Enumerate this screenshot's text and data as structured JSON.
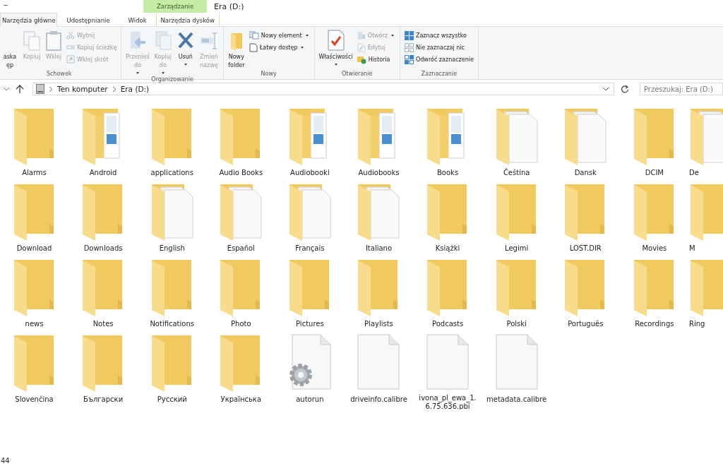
{
  "window": {
    "title": "Era (D:)"
  },
  "context_group": "Zarządzanie",
  "tabs": [
    {
      "label": "Narzędzia główne",
      "selected": true,
      "kind": "normal"
    },
    {
      "label": "Udostępnianie",
      "selected": false,
      "kind": "normal"
    },
    {
      "label": "Widok",
      "selected": false,
      "kind": "normal"
    },
    {
      "label": "Narzędzia dysków",
      "selected": false,
      "kind": "context"
    }
  ],
  "ribbon": [
    {
      "label": "Schowek",
      "items": [
        {
          "kind": "big",
          "label": "aska\nęp",
          "disabled": false,
          "dropdown": false
        },
        {
          "kind": "big",
          "label": "Kopiuj",
          "disabled": true,
          "dropdown": false
        },
        {
          "kind": "big",
          "label": "Wklej",
          "disabled": true,
          "dropdown": false
        },
        {
          "kind": "stack",
          "entries": [
            {
              "label": "Wytnij",
              "disabled": true,
              "dropdown": false
            },
            {
              "label": "Kopiuj ścieżkę",
              "disabled": true,
              "dropdown": false
            },
            {
              "label": "Wklej skrót",
              "disabled": true,
              "dropdown": false
            }
          ]
        }
      ]
    },
    {
      "label": "Organizowanie",
      "items": [
        {
          "kind": "big",
          "label": "Przenieś\ndo",
          "disabled": true,
          "dropdown": true
        },
        {
          "kind": "big",
          "label": "Kopiuj\ndo",
          "disabled": true,
          "dropdown": true
        },
        {
          "kind": "big",
          "label": "Usuń",
          "disabled": false,
          "dropdown": true
        },
        {
          "kind": "big",
          "label": "Zmień\nnazwę",
          "disabled": true,
          "dropdown": false
        }
      ]
    },
    {
      "label": "Nowy",
      "items": [
        {
          "kind": "big",
          "label": "Nowy\nfolder",
          "disabled": false,
          "dropdown": false
        },
        {
          "kind": "stack",
          "entries": [
            {
              "label": "Nowy element",
              "disabled": false,
              "dropdown": true
            },
            {
              "label": "Łatwy dostęp",
              "disabled": false,
              "dropdown": true
            }
          ]
        }
      ]
    },
    {
      "label": "Otwieranie",
      "items": [
        {
          "kind": "big",
          "label": "Właściwości",
          "disabled": false,
          "dropdown": true
        },
        {
          "kind": "stack",
          "entries": [
            {
              "label": "Otwórz",
              "disabled": true,
              "dropdown": true
            },
            {
              "label": "Edytuj",
              "disabled": true,
              "dropdown": false
            },
            {
              "label": "Historia",
              "disabled": false,
              "dropdown": false
            }
          ]
        }
      ]
    },
    {
      "label": "Zaznaczanie",
      "items": [
        {
          "kind": "stack",
          "entries": [
            {
              "label": "Zaznacz wszystko",
              "disabled": false,
              "dropdown": false
            },
            {
              "label": "Nie zaznaczaj nic",
              "disabled": false,
              "dropdown": false
            },
            {
              "label": "Odwróć zaznaczenie",
              "disabled": false,
              "dropdown": false
            }
          ]
        }
      ]
    }
  ],
  "address": {
    "path": [
      "Ten komputer",
      "Era (D:)"
    ],
    "search_placeholder": "Przeszukaj: Era (D:)"
  },
  "items": [
    {
      "name": "Alarms",
      "kind": "folder"
    },
    {
      "name": "Android",
      "kind": "folder-docs"
    },
    {
      "name": "applications",
      "kind": "folder"
    },
    {
      "name": "Audio Books",
      "kind": "folder"
    },
    {
      "name": "Audiobooki",
      "kind": "folder-docs"
    },
    {
      "name": "Audiobooks",
      "kind": "folder-docs"
    },
    {
      "name": "Books",
      "kind": "folder-docs"
    },
    {
      "name": "Čeština",
      "kind": "folder-pages"
    },
    {
      "name": "Dansk",
      "kind": "folder-pages"
    },
    {
      "name": "DCIM",
      "kind": "folder"
    },
    {
      "name": "De",
      "kind": "folder-pages"
    },
    {
      "name": "Download",
      "kind": "folder"
    },
    {
      "name": "Downloads",
      "kind": "folder"
    },
    {
      "name": "English",
      "kind": "folder-pages"
    },
    {
      "name": "Español",
      "kind": "folder-pages"
    },
    {
      "name": "Français",
      "kind": "folder-pages"
    },
    {
      "name": "Italiano",
      "kind": "folder-pages"
    },
    {
      "name": "Książki",
      "kind": "folder"
    },
    {
      "name": "Legimi",
      "kind": "folder"
    },
    {
      "name": "LOST.DIR",
      "kind": "folder"
    },
    {
      "name": "Movies",
      "kind": "folder"
    },
    {
      "name": "M",
      "kind": "folder"
    },
    {
      "name": "news",
      "kind": "folder"
    },
    {
      "name": "Notes",
      "kind": "folder"
    },
    {
      "name": "Notifications",
      "kind": "folder"
    },
    {
      "name": "Photo",
      "kind": "folder"
    },
    {
      "name": "Pictures",
      "kind": "folder"
    },
    {
      "name": "Playlists",
      "kind": "folder"
    },
    {
      "name": "Podcasts",
      "kind": "folder"
    },
    {
      "name": "Polski",
      "kind": "folder"
    },
    {
      "name": "Português",
      "kind": "folder"
    },
    {
      "name": "Recordings",
      "kind": "folder"
    },
    {
      "name": "Ring",
      "kind": "folder"
    },
    {
      "name": "Slovenčina",
      "kind": "folder"
    },
    {
      "name": "Български",
      "kind": "folder"
    },
    {
      "name": "Русский",
      "kind": "folder"
    },
    {
      "name": "Українська",
      "kind": "folder"
    },
    {
      "name": "autorun",
      "kind": "file-gear"
    },
    {
      "name": "driveinfo.calibre",
      "kind": "file"
    },
    {
      "name": "ivona_pl_ewa_1.6.75.636.pbi",
      "kind": "file"
    },
    {
      "name": "metadata.calibre",
      "kind": "file"
    }
  ],
  "status_bar": {
    "count": "44"
  }
}
